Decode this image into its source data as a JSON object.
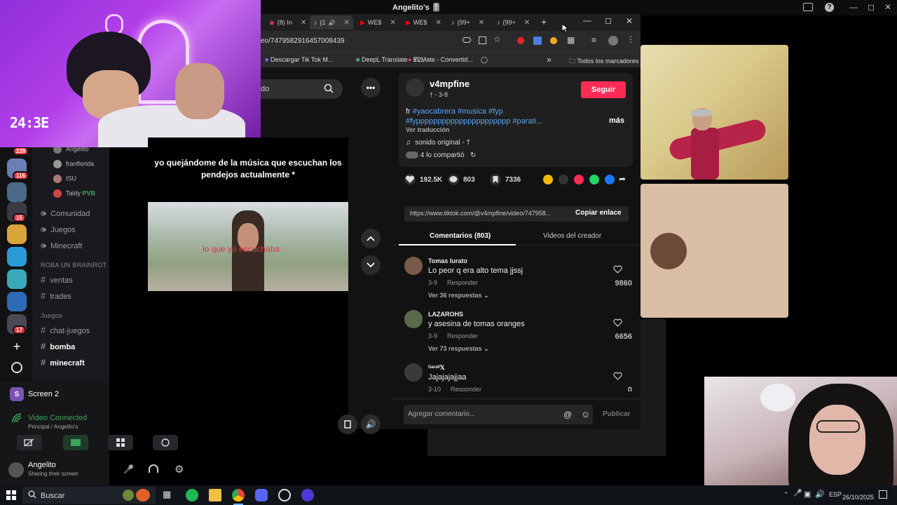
{
  "window": {
    "title": "Angelito's 🎚"
  },
  "discord": {
    "badges": [
      "239",
      "116",
      "15",
      "17"
    ],
    "voice_users": [
      {
        "name": "Angelito"
      },
      {
        "name": "franflorida"
      },
      {
        "name": "ISU"
      },
      {
        "name": "Taldy",
        "tag": "PVB"
      }
    ],
    "channels_top": [
      {
        "label": "Comunidad"
      },
      {
        "label": "Juegos"
      },
      {
        "label": "Minecraft"
      }
    ],
    "category_1": "ROBA UN BRAINROT",
    "channels_mid": [
      {
        "label": "ventas"
      },
      {
        "label": "trades"
      }
    ],
    "category_2": "Juegos",
    "channels_bottom": [
      {
        "label": "chat-juegos"
      },
      {
        "label": "bomba"
      },
      {
        "label": "minecraft"
      }
    ],
    "screen_share": {
      "icon_letter": "S",
      "label": "Screen 2"
    },
    "voice": {
      "status": "Video Connected",
      "channel": "Principal / Angelito's"
    },
    "user": {
      "name": "Angelito",
      "status": "Sharing their screen"
    }
  },
  "webcam": {
    "clock": "24:3E"
  },
  "browser": {
    "tabs": [
      {
        "label": "(8) In"
      },
      {
        "label": "(1"
      },
      {
        "label": "WE$"
      },
      {
        "label": "WE$"
      },
      {
        "label": "(99+"
      },
      {
        "label": "(99+"
      }
    ],
    "new_tab": "+",
    "url": "eo/7479582916457008439",
    "bookmarks": [
      {
        "label": "Descargar Tik Tok M..."
      },
      {
        "label": "DeepL Translate - El..."
      },
      {
        "label": "Y2Mate - Convertid..."
      }
    ],
    "bookmarks_overflow": "»",
    "all_bookmarks": "Todos los marcadores"
  },
  "tiktok": {
    "search_text": "do",
    "video": {
      "caption": "yo quejándome de la música que escuchan los pendejos actualmente *",
      "overlay": "lo que yo escuchaba :"
    },
    "creator": {
      "name": "v4mpfine",
      "sub": "† - 3-8",
      "follow": "Seguir"
    },
    "description": {
      "prefix": "fr ",
      "tags_line1": "#yaocabrera #musica #fyp",
      "tags_line2": "#fypppppppppppppppppppppp #parati...",
      "more": "más",
      "translate": "Ver traducción"
    },
    "sound": "sonido original - †",
    "shared": "4 lo compartió",
    "stats": {
      "likes": "192.5K",
      "comments": "803",
      "saves": "7336"
    },
    "link": {
      "url": "https://www.tiktok.com/@v4mpfine/video/747958...",
      "copy": "Copiar enlace"
    },
    "comment_tabs": {
      "comments": "Comentarios (803)",
      "creator_videos": "Videos del creador"
    },
    "comments": [
      {
        "user": "Tomas Iurato",
        "text": "Lo peor q era alto tema jjssj",
        "date": "3-9",
        "reply": "Responder",
        "more": "Ver 36 respuestas",
        "likes": "9860"
      },
      {
        "user": "LAZAROHS",
        "text": "y asesina de tomas oranges",
        "date": "3-9",
        "reply": "Responder",
        "more": "Ver 73 respuestas",
        "likes": "6656"
      },
      {
        "user": "ᴳᵃʳᵉˡⁱ𝕏",
        "text": "Jajajajajjaa",
        "date": "3-10",
        "reply": "Responder",
        "more": "",
        "likes": "0"
      }
    ],
    "comment_input": {
      "placeholder": "Agregar comentario...",
      "publish": "Publicar"
    }
  },
  "taskbar": {
    "search": "Buscar",
    "lang": "ESP",
    "date": "26/10/2025"
  },
  "colors": {
    "tiktok_red": "#fe2c55",
    "hashtag_blue": "#5ba4f5",
    "discord_green": "#3ba55c",
    "webcam_purple": "#b23fe8"
  }
}
